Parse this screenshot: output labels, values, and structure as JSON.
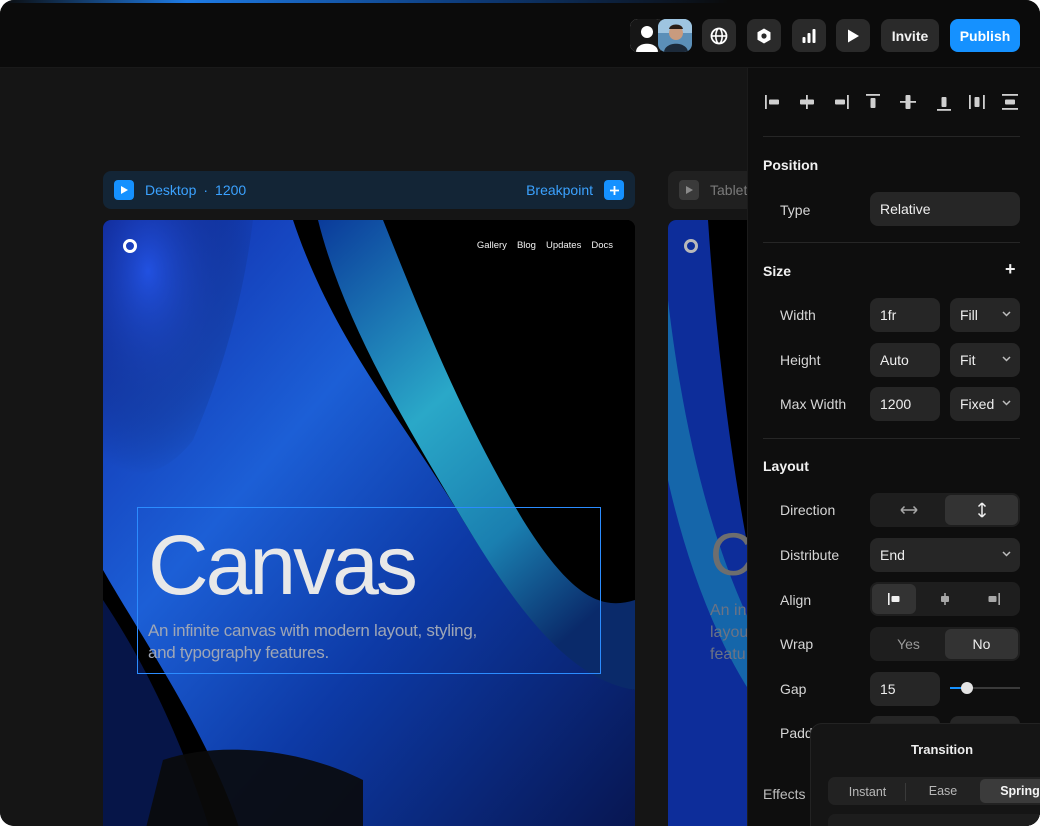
{
  "topbar": {
    "invite_label": "Invite",
    "publish_label": "Publish",
    "icons": [
      "user-icon",
      "globe-icon",
      "hexagon-icon",
      "chart-icon",
      "play-icon"
    ],
    "publish_color": "#1591ff"
  },
  "frames": {
    "desktop": {
      "name": "Desktop",
      "separator": "·",
      "width": "1200",
      "breakpoint_label": "Breakpoint"
    },
    "tablet": {
      "name": "Tablet"
    }
  },
  "site": {
    "nav_links": [
      "Gallery",
      "Blog",
      "Updates",
      "Docs"
    ],
    "hero_title": "Canvas",
    "hero_subtitle": "An infinite canvas with modern layout, styling, and typography features.",
    "tablet_hero_title_fragment": "C",
    "tablet_subtitle_fragment": "An in layou featu"
  },
  "panel": {
    "position": {
      "title": "Position",
      "type_label": "Type",
      "type_value": "Relative"
    },
    "size": {
      "title": "Size",
      "add": "+",
      "width_label": "Width",
      "width_value": "1fr",
      "width_mode": "Fill",
      "height_label": "Height",
      "height_value": "Auto",
      "height_mode": "Fit",
      "maxwidth_label": "Max Width",
      "maxwidth_value": "1200",
      "maxwidth_mode": "Fixed"
    },
    "layout": {
      "title": "Layout",
      "direction_label": "Direction",
      "distribute_label": "Distribute",
      "distribute_value": "End",
      "align_label": "Align",
      "wrap_label": "Wrap",
      "wrap_yes": "Yes",
      "wrap_no": "No",
      "gap_label": "Gap",
      "gap_value": "15",
      "padding_label": "Padd"
    },
    "effects": {
      "title": "Effects"
    }
  },
  "transition_popup": {
    "title": "Transition",
    "options": [
      "Instant",
      "Ease",
      "Spring"
    ],
    "selected": "Spring"
  }
}
